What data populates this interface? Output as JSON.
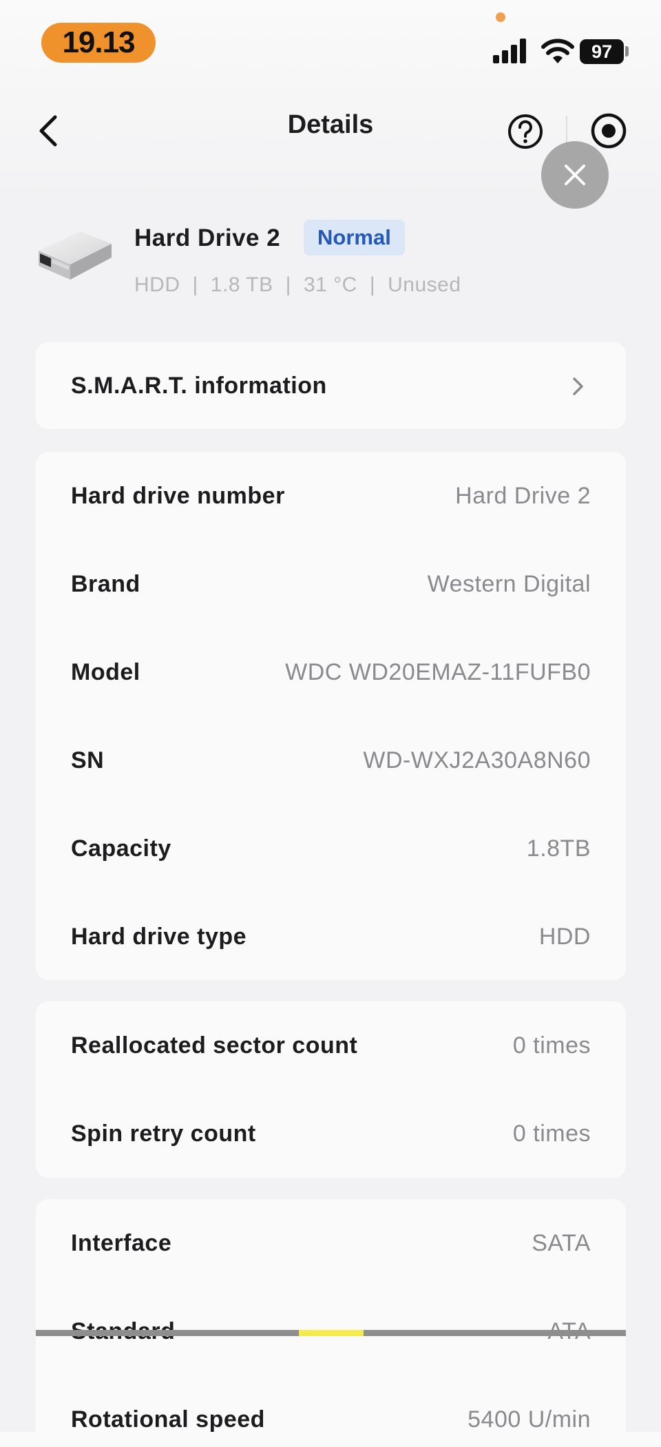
{
  "status_bar": {
    "time": "19.13",
    "battery": "97",
    "icons": [
      "signal-icon",
      "wifi-icon",
      "battery-icon"
    ]
  },
  "nav": {
    "title": "Details",
    "icons": [
      "back-chevron-icon",
      "help-icon",
      "record-icon",
      "close-icon"
    ]
  },
  "drive": {
    "name": "Hard Drive 2",
    "status": "Normal",
    "meta": [
      "HDD",
      "1.8 TB",
      "31 °C",
      "Unused"
    ]
  },
  "smart": {
    "label": "S.M.A.R.T. information"
  },
  "info": [
    {
      "label": "Hard drive number",
      "value": "Hard Drive 2"
    },
    {
      "label": "Brand",
      "value": "Western Digital"
    },
    {
      "label": "Model",
      "value": "WDC WD20EMAZ-11FUFB0"
    },
    {
      "label": "SN",
      "value": "WD-WXJ2A30A8N60"
    },
    {
      "label": "Capacity",
      "value": "1.8TB"
    },
    {
      "label": "Hard drive type",
      "value": "HDD"
    }
  ],
  "health": [
    {
      "label": "Reallocated sector count",
      "value": "0 times"
    },
    {
      "label": "Spin retry count",
      "value": "0 times"
    }
  ],
  "specs": [
    {
      "label": "Interface",
      "value": "SATA"
    },
    {
      "label": "Standard",
      "value": "ATA"
    },
    {
      "label": "Rotational speed",
      "value": "5400 U/min"
    }
  ],
  "colors": {
    "accent_orange": "#f0922b",
    "badge_bg": "#dbe6f7",
    "badge_text": "#2459b8",
    "card_bg": "#fafafa",
    "page_bg": "#f2f2f4"
  }
}
